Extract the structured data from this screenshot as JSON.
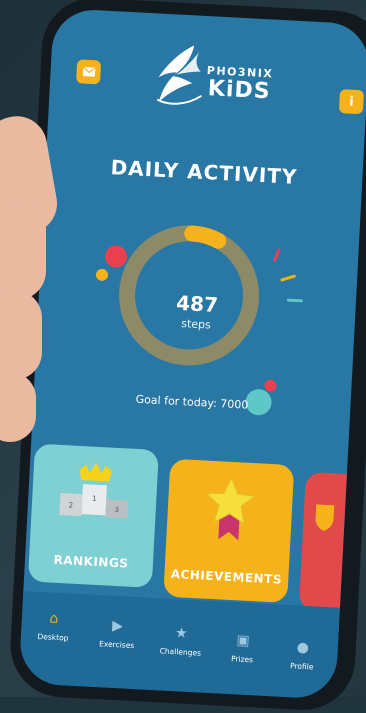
{
  "header": {
    "brand_top": "PHO3NIX",
    "brand_bottom": "KiDS",
    "mail_icon": "mail-icon",
    "info_label": "i"
  },
  "activity": {
    "title": "DAILY ACTIVITY",
    "steps": "487",
    "steps_unit": "steps",
    "goal_text": "Goal for today: 7000",
    "progress": 0.0696
  },
  "cards": [
    {
      "label": "RANKINGS",
      "color": "#7fd0d2",
      "icon": "podium-icon"
    },
    {
      "label": "ACHIEVEMENTS",
      "color": "#f6b21b",
      "icon": "star-medal-icon"
    },
    {
      "label": "",
      "color": "#e04a4a",
      "icon": "shield-icon"
    }
  ],
  "nav": [
    {
      "label": "Desktop",
      "icon": "home-icon",
      "active": true
    },
    {
      "label": "Exercises",
      "icon": "play-icon",
      "active": false
    },
    {
      "label": "Challenges",
      "icon": "star-icon",
      "active": false
    },
    {
      "label": "Prizes",
      "icon": "gift-icon",
      "active": false
    },
    {
      "label": "Profile",
      "icon": "user-icon",
      "active": false
    }
  ],
  "colors": {
    "screen_bg": "#2877a4",
    "accent": "#f6b21b",
    "ring_track": "#8d8a68",
    "nav_bg": "#1f6a96"
  }
}
